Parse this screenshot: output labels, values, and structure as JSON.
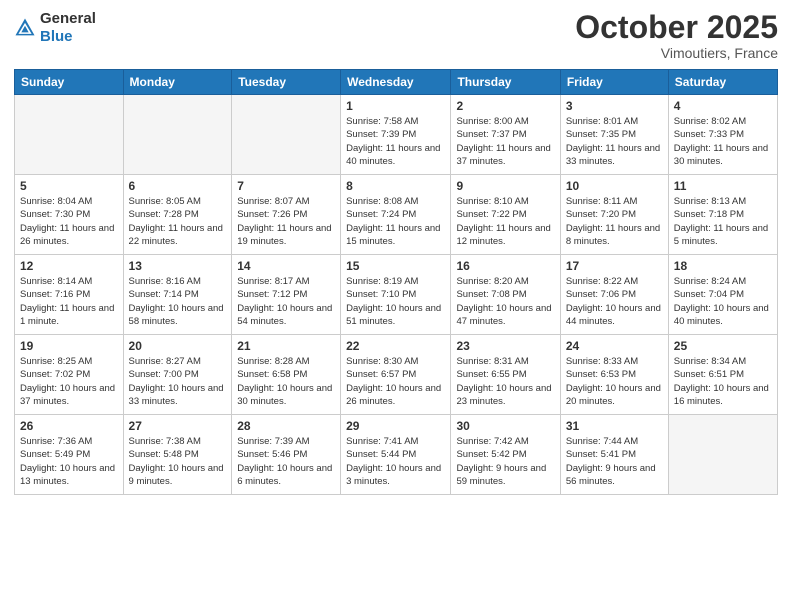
{
  "header": {
    "logo_line1": "General",
    "logo_line2": "Blue",
    "month": "October 2025",
    "location": "Vimoutiers, France"
  },
  "days_of_week": [
    "Sunday",
    "Monday",
    "Tuesday",
    "Wednesday",
    "Thursday",
    "Friday",
    "Saturday"
  ],
  "weeks": [
    [
      {
        "day": "",
        "info": ""
      },
      {
        "day": "",
        "info": ""
      },
      {
        "day": "",
        "info": ""
      },
      {
        "day": "1",
        "info": "Sunrise: 7:58 AM\nSunset: 7:39 PM\nDaylight: 11 hours\nand 40 minutes."
      },
      {
        "day": "2",
        "info": "Sunrise: 8:00 AM\nSunset: 7:37 PM\nDaylight: 11 hours\nand 37 minutes."
      },
      {
        "day": "3",
        "info": "Sunrise: 8:01 AM\nSunset: 7:35 PM\nDaylight: 11 hours\nand 33 minutes."
      },
      {
        "day": "4",
        "info": "Sunrise: 8:02 AM\nSunset: 7:33 PM\nDaylight: 11 hours\nand 30 minutes."
      }
    ],
    [
      {
        "day": "5",
        "info": "Sunrise: 8:04 AM\nSunset: 7:30 PM\nDaylight: 11 hours\nand 26 minutes."
      },
      {
        "day": "6",
        "info": "Sunrise: 8:05 AM\nSunset: 7:28 PM\nDaylight: 11 hours\nand 22 minutes."
      },
      {
        "day": "7",
        "info": "Sunrise: 8:07 AM\nSunset: 7:26 PM\nDaylight: 11 hours\nand 19 minutes."
      },
      {
        "day": "8",
        "info": "Sunrise: 8:08 AM\nSunset: 7:24 PM\nDaylight: 11 hours\nand 15 minutes."
      },
      {
        "day": "9",
        "info": "Sunrise: 8:10 AM\nSunset: 7:22 PM\nDaylight: 11 hours\nand 12 minutes."
      },
      {
        "day": "10",
        "info": "Sunrise: 8:11 AM\nSunset: 7:20 PM\nDaylight: 11 hours\nand 8 minutes."
      },
      {
        "day": "11",
        "info": "Sunrise: 8:13 AM\nSunset: 7:18 PM\nDaylight: 11 hours\nand 5 minutes."
      }
    ],
    [
      {
        "day": "12",
        "info": "Sunrise: 8:14 AM\nSunset: 7:16 PM\nDaylight: 11 hours\nand 1 minute."
      },
      {
        "day": "13",
        "info": "Sunrise: 8:16 AM\nSunset: 7:14 PM\nDaylight: 10 hours\nand 58 minutes."
      },
      {
        "day": "14",
        "info": "Sunrise: 8:17 AM\nSunset: 7:12 PM\nDaylight: 10 hours\nand 54 minutes."
      },
      {
        "day": "15",
        "info": "Sunrise: 8:19 AM\nSunset: 7:10 PM\nDaylight: 10 hours\nand 51 minutes."
      },
      {
        "day": "16",
        "info": "Sunrise: 8:20 AM\nSunset: 7:08 PM\nDaylight: 10 hours\nand 47 minutes."
      },
      {
        "day": "17",
        "info": "Sunrise: 8:22 AM\nSunset: 7:06 PM\nDaylight: 10 hours\nand 44 minutes."
      },
      {
        "day": "18",
        "info": "Sunrise: 8:24 AM\nSunset: 7:04 PM\nDaylight: 10 hours\nand 40 minutes."
      }
    ],
    [
      {
        "day": "19",
        "info": "Sunrise: 8:25 AM\nSunset: 7:02 PM\nDaylight: 10 hours\nand 37 minutes."
      },
      {
        "day": "20",
        "info": "Sunrise: 8:27 AM\nSunset: 7:00 PM\nDaylight: 10 hours\nand 33 minutes."
      },
      {
        "day": "21",
        "info": "Sunrise: 8:28 AM\nSunset: 6:58 PM\nDaylight: 10 hours\nand 30 minutes."
      },
      {
        "day": "22",
        "info": "Sunrise: 8:30 AM\nSunset: 6:57 PM\nDaylight: 10 hours\nand 26 minutes."
      },
      {
        "day": "23",
        "info": "Sunrise: 8:31 AM\nSunset: 6:55 PM\nDaylight: 10 hours\nand 23 minutes."
      },
      {
        "day": "24",
        "info": "Sunrise: 8:33 AM\nSunset: 6:53 PM\nDaylight: 10 hours\nand 20 minutes."
      },
      {
        "day": "25",
        "info": "Sunrise: 8:34 AM\nSunset: 6:51 PM\nDaylight: 10 hours\nand 16 minutes."
      }
    ],
    [
      {
        "day": "26",
        "info": "Sunrise: 7:36 AM\nSunset: 5:49 PM\nDaylight: 10 hours\nand 13 minutes."
      },
      {
        "day": "27",
        "info": "Sunrise: 7:38 AM\nSunset: 5:48 PM\nDaylight: 10 hours\nand 9 minutes."
      },
      {
        "day": "28",
        "info": "Sunrise: 7:39 AM\nSunset: 5:46 PM\nDaylight: 10 hours\nand 6 minutes."
      },
      {
        "day": "29",
        "info": "Sunrise: 7:41 AM\nSunset: 5:44 PM\nDaylight: 10 hours\nand 3 minutes."
      },
      {
        "day": "30",
        "info": "Sunrise: 7:42 AM\nSunset: 5:42 PM\nDaylight: 9 hours\nand 59 minutes."
      },
      {
        "day": "31",
        "info": "Sunrise: 7:44 AM\nSunset: 5:41 PM\nDaylight: 9 hours\nand 56 minutes."
      },
      {
        "day": "",
        "info": ""
      }
    ]
  ]
}
